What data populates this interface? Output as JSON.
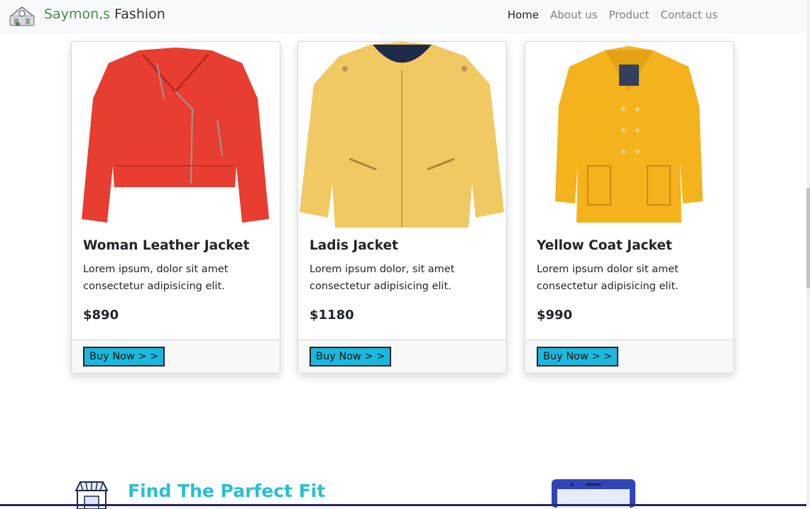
{
  "brand": {
    "part1": "Saymon,s",
    "part2": "Fashion"
  },
  "nav": [
    {
      "label": "Home",
      "active": true
    },
    {
      "label": "About us",
      "active": false
    },
    {
      "label": "Product",
      "active": false
    },
    {
      "label": "Contact us",
      "active": false
    }
  ],
  "products": [
    {
      "title": "Woman Leather Jacket",
      "text": "Lorem ipsum, dolor sit amet consectetur adipisicing elit.",
      "price": "$890",
      "button": "Buy Now > >",
      "color": "#e93a30"
    },
    {
      "title": "Ladis Jacket",
      "text": "Lorem ipsum dolor, sit amet consectetur adipisicing elit.",
      "price": "$1180",
      "button": "Buy Now > >",
      "color": "#f0c75e"
    },
    {
      "title": "Yellow Coat Jacket",
      "text": "Lorem ipsum dolor sit amet consectetur adipisicing elit.",
      "price": "$990",
      "button": "Buy Now > >",
      "color": "#f4b41e"
    }
  ],
  "feature": {
    "title": "Find The Parfect Fit"
  },
  "colors": {
    "accent": "#1bb8de",
    "title": "#27c0cf",
    "brand": "#4a8a4d"
  }
}
